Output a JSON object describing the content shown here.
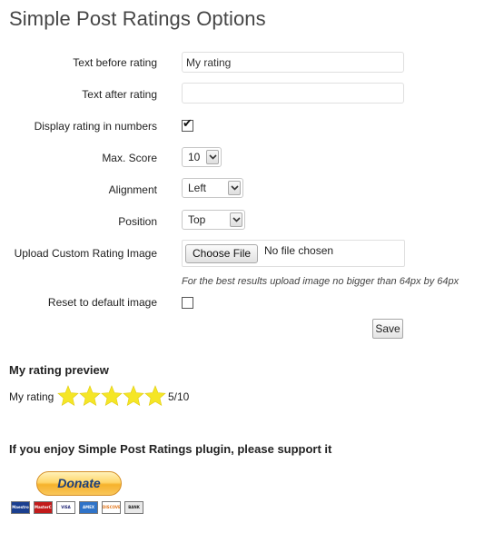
{
  "page": {
    "title": "Simple Post Ratings Options"
  },
  "form": {
    "text_before": {
      "label": "Text before rating",
      "value": "My rating"
    },
    "text_after": {
      "label": "Text after rating",
      "value": ""
    },
    "display_numbers": {
      "label": "Display rating in numbers",
      "checked": true
    },
    "max_score": {
      "label": "Max. Score",
      "selected": "10"
    },
    "alignment": {
      "label": "Alignment",
      "selected": "Left"
    },
    "position": {
      "label": "Position",
      "selected": "Top"
    },
    "upload": {
      "label": "Upload Custom Rating Image",
      "button_label": "Choose File",
      "status": "No file chosen",
      "hint": "For the best results upload image no bigger than 64px by 64px"
    },
    "reset": {
      "label": "Reset to default image",
      "checked": false
    },
    "save_label": "Save"
  },
  "preview": {
    "heading": "My rating preview",
    "label": "My rating",
    "star_count": 5,
    "score_text": "5/10",
    "star_color": "#f5e626"
  },
  "support": {
    "heading": "If you enjoy Simple Post Ratings plugin, please support it",
    "donate_label": "Donate",
    "cards": [
      "Maestro",
      "MasterCard",
      "VISA",
      "AMEX",
      "DISCOVER",
      "BANK"
    ]
  }
}
